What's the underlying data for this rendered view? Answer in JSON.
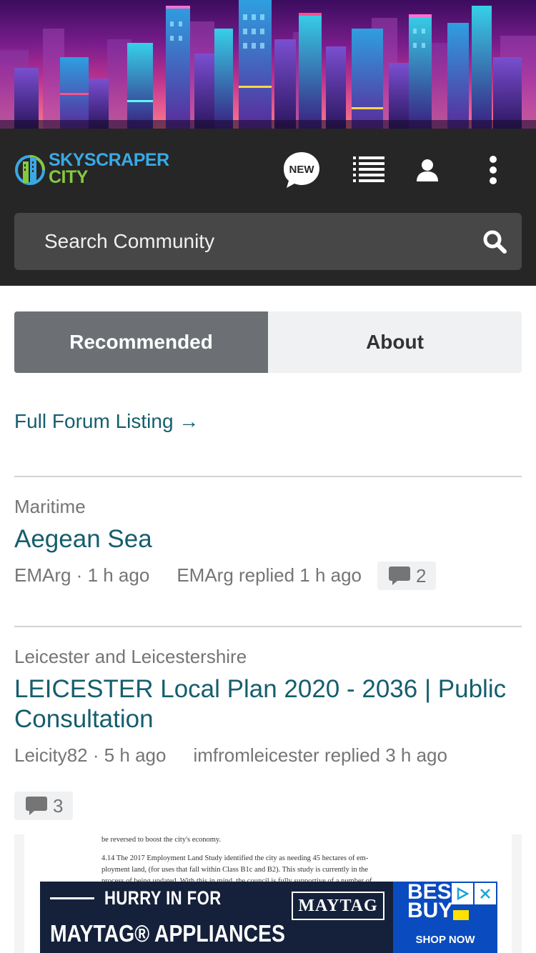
{
  "header": {
    "logo_line1": "SKYSCRAPER",
    "logo_line2": "CITY",
    "new_badge": "NEW"
  },
  "search": {
    "placeholder": "Search Community"
  },
  "tabs": [
    {
      "label": "Recommended",
      "active": true
    },
    {
      "label": "About",
      "active": false
    }
  ],
  "full_listing_link": "Full Forum Listing →",
  "threads": [
    {
      "forum": "Maritime",
      "title": "Aegean Sea",
      "author_time": "EMArg · 1 h ago",
      "last_reply": "EMArg replied 1 h ago",
      "replies": "2"
    },
    {
      "forum": "Leicester and Leicestershire",
      "title": "LEICESTER Local Plan 2020 - 2036 | Public Consultation",
      "author_time": "Leicity82 · 5 h ago",
      "last_reply": "imfromleicester replied 3 h ago",
      "replies": "3"
    }
  ],
  "preview": {
    "line1": "be reversed to boost the city's economy.",
    "line2": "4.14 The 2017 Employment Land Study identified the city as needing 45 hectares of em-",
    "line3": "ployment land, (for uses that fall within Class B1c and B2). This study is currently in the",
    "line4": "process of being updated. With this in mind, the council is fully supportive of a number of"
  },
  "ad": {
    "line1": "HURRY IN FOR",
    "brand": "MAYTAG",
    "line2": "MAYTAG® APPLIANCES",
    "store": "BEST BUY",
    "cta": "SHOP NOW"
  },
  "colors": {
    "header_bg": "#262626",
    "search_bg": "#474747",
    "link": "#155e6e",
    "tab_active": "#6c7075",
    "tab_inactive": "#eff1f3",
    "logo_blue": "#39a9e6",
    "logo_green": "#86c93f"
  }
}
